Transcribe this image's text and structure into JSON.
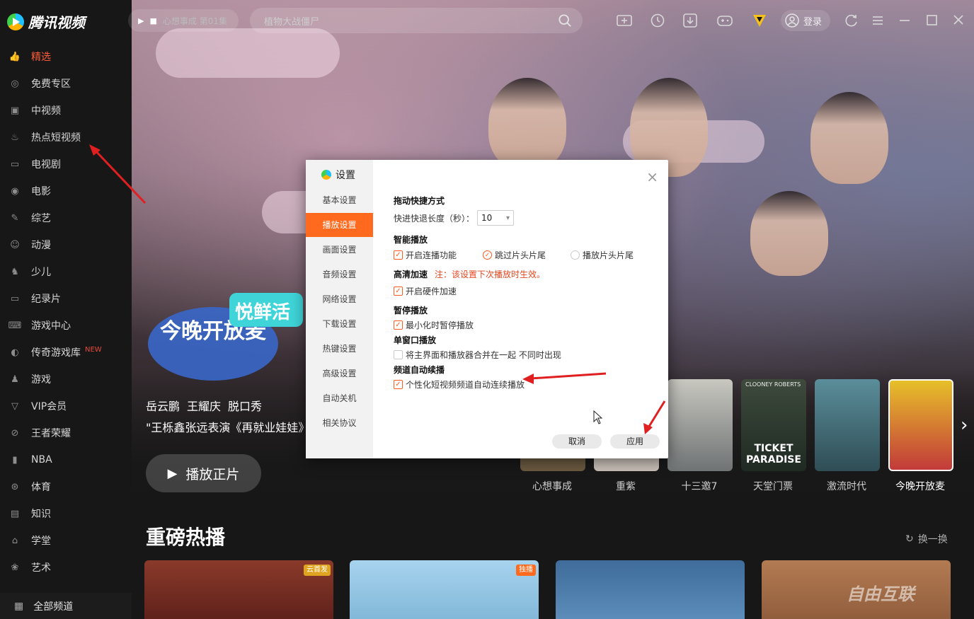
{
  "app": {
    "name": "腾讯视频"
  },
  "topbar": {
    "now_playing": "心想事成 第01集",
    "search_placeholder": "植物大战僵尸",
    "login_label": "登录",
    "icons": [
      "add-screen-icon",
      "history-icon",
      "download-icon",
      "game-icon",
      "vip-icon",
      "refresh-icon",
      "menu-icon",
      "minimize-icon",
      "maximize-icon",
      "close-icon"
    ]
  },
  "sidebar": {
    "items": [
      {
        "label": "精选",
        "icon": "thumbs-up-icon",
        "active": true
      },
      {
        "label": "免费专区",
        "icon": "free-icon"
      },
      {
        "label": "中视频",
        "icon": "video-icon"
      },
      {
        "label": "热点短视频",
        "icon": "fire-icon"
      },
      {
        "label": "电视剧",
        "icon": "tv-icon"
      },
      {
        "label": "电影",
        "icon": "film-icon"
      },
      {
        "label": "综艺",
        "icon": "mic-icon"
      },
      {
        "label": "动漫",
        "icon": "anime-icon"
      },
      {
        "label": "少儿",
        "icon": "kids-icon"
      },
      {
        "label": "纪录片",
        "icon": "camera-icon"
      },
      {
        "label": "游戏中心",
        "icon": "gamepad-icon"
      },
      {
        "label": "传奇游戏库",
        "icon": "legend-icon",
        "badge": "NEW"
      },
      {
        "label": "游戏",
        "icon": "joystick-icon"
      },
      {
        "label": "VIP会员",
        "icon": "vip-icon"
      },
      {
        "label": "王者荣耀",
        "icon": "honor-icon"
      },
      {
        "label": "NBA",
        "icon": "nba-icon"
      },
      {
        "label": "体育",
        "icon": "ball-icon"
      },
      {
        "label": "知识",
        "icon": "book-icon"
      },
      {
        "label": "学堂",
        "icon": "school-icon"
      },
      {
        "label": "艺术",
        "icon": "palette-icon"
      }
    ],
    "all_channels": "全部频道"
  },
  "hero": {
    "show_logo_text": "今晚开放麦",
    "show_logo_sub": "悦鲜活",
    "tags": [
      "岳云鹏",
      "王耀庆",
      "脱口秀"
    ],
    "description": "\"王栎鑫张远表演《再就业娃娃》",
    "play_label": "播放正片"
  },
  "thumbnails": [
    {
      "label": "心想事成",
      "color": "#6b5a40"
    },
    {
      "label": "重紫",
      "color": "#c9c0b8"
    },
    {
      "label": "十三邀7",
      "color": "#7b7f80"
    },
    {
      "label": "天堂门票",
      "color": "#3d4a3c",
      "poster_text": "TICKET PARADISE",
      "poster_top": "CLOONEY ROBERTS"
    },
    {
      "label": "激流时代",
      "color": "#3a5a66"
    },
    {
      "label": "今晚开放麦",
      "color": "#c23a3a",
      "current": true
    }
  ],
  "section": {
    "title": "重磅热播",
    "refresh_label": "换一换",
    "cards": [
      {
        "badge": "云首发",
        "badge_color": "#e0a520",
        "color": "#7a2f27"
      },
      {
        "badge": "独播",
        "badge_color": "#ff6a1f",
        "color": "#8fc1e0"
      },
      {
        "badge": "",
        "badge_color": "",
        "color": "#3f6c9a"
      },
      {
        "badge": "",
        "badge_color": "",
        "color": "#b37b52"
      }
    ]
  },
  "dialog": {
    "title": "设置",
    "nav": [
      "基本设置",
      "播放设置",
      "画面设置",
      "音频设置",
      "网络设置",
      "下载设置",
      "热键设置",
      "高级设置",
      "自动关机",
      "相关协议"
    ],
    "active_nav": "播放设置",
    "sections": {
      "drag": {
        "title": "拖动快捷方式",
        "label": "快进快退长度（秒）：",
        "value": "10"
      },
      "smart": {
        "title": "智能播放",
        "opt1": "开启连播功能",
        "opt2": "跳过片头片尾",
        "opt3": "播放片头片尾"
      },
      "hd": {
        "title": "高清加速",
        "note": "注：该设置下次播放时生效。",
        "opt": "开启硬件加速"
      },
      "pause": {
        "title": "暂停播放",
        "opt": "最小化时暂停播放"
      },
      "single": {
        "title": "单窗口播放",
        "opt": "将主界面和播放器合并在一起 不同时出现"
      },
      "auto": {
        "title": "频道自动续播",
        "opt": "个性化短视频频道自动连续播放"
      }
    },
    "cancel_label": "取消",
    "apply_label": "应用"
  },
  "watermark": "自由互联"
}
